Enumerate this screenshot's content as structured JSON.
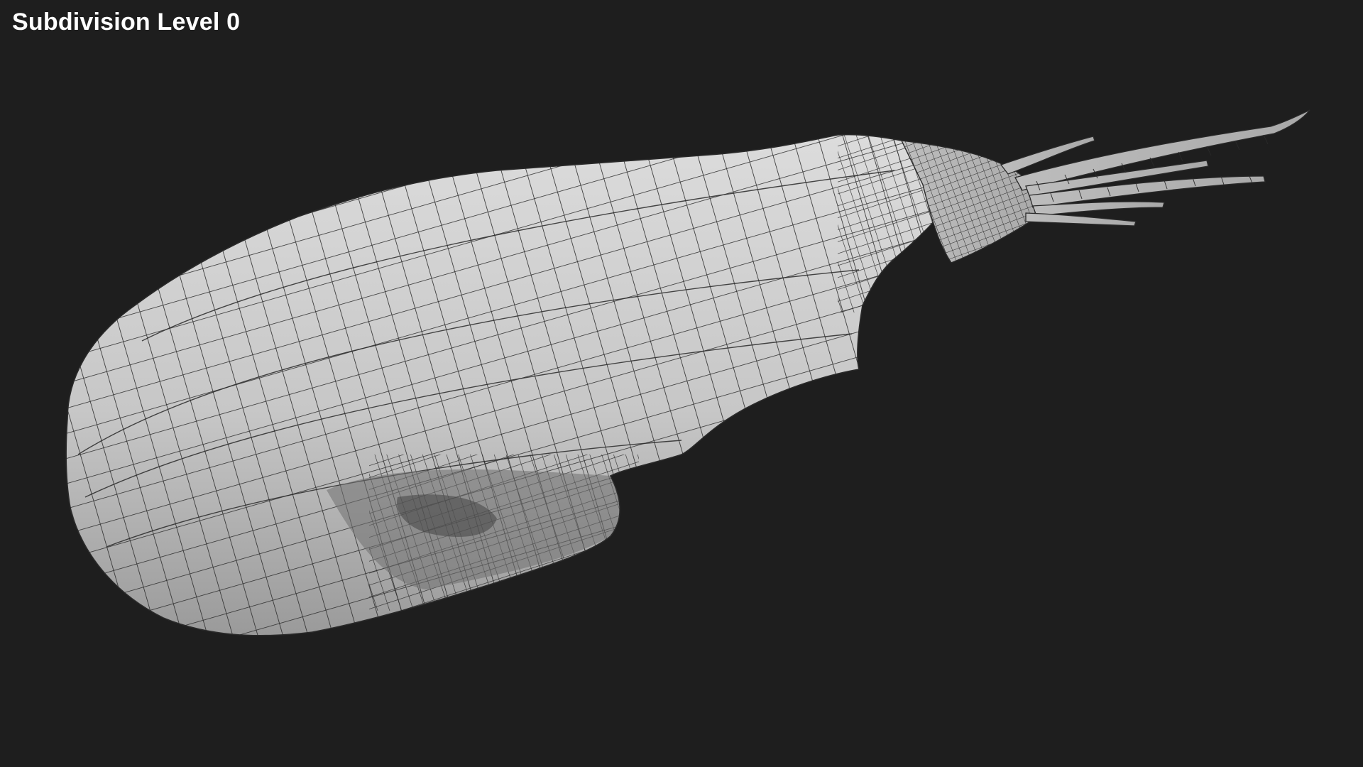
{
  "viewport": {
    "label": "Subdivision Level 0",
    "background_color": "#1e1e1e",
    "mesh_fill_color": "#c9c9c9",
    "wire_color": "#2a2a2a",
    "model_icon": "wireframe-mesh-model"
  }
}
